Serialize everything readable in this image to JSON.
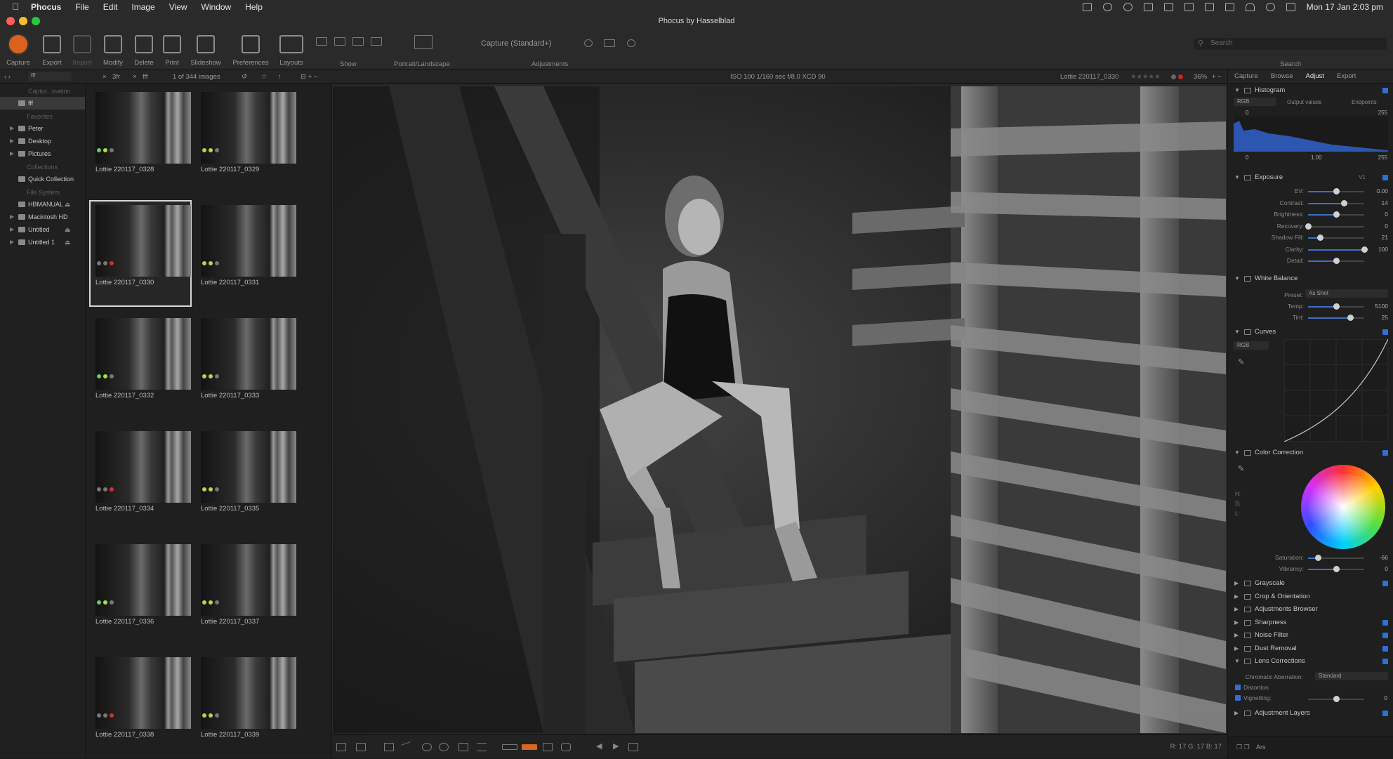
{
  "menubar": {
    "app": "Phocus",
    "items": [
      "File",
      "Edit",
      "Image",
      "View",
      "Window",
      "Help"
    ],
    "clock": "Mon 17 Jan  2:03 pm"
  },
  "window": {
    "title": "Phocus by Hasselblad"
  },
  "toolbar": {
    "buttons": [
      "Capture",
      "Export",
      "Import",
      "Modify",
      "Delete",
      "Print",
      "Slideshow",
      "Preferences",
      "Layouts"
    ],
    "show_label": "Show",
    "orientation_label": "Portrait/Landscape",
    "capture_preset": "Capture (Standard+)",
    "adjustments_label": "Adjustments",
    "search_placeholder": "Search",
    "search_label": "Search"
  },
  "subbar": {
    "tab1": "3fr",
    "tab2": "fff",
    "count": "1 of 344 images",
    "exif": "ISO 100   1/160 sec   f/8.0   XCD 90",
    "filename": "Lottie 220117_0330",
    "zoom": "36%"
  },
  "sidebar": {
    "path": "Captur...ination",
    "folder": "fff",
    "favorites_title": "Favorites",
    "favorites": [
      "Peter",
      "Desktop",
      "Pictures"
    ],
    "collections_title": "Collections",
    "quick": "Quick Collection",
    "filesystem_title": "File System",
    "volumes": [
      "HBMANUAL",
      "Macintosh HD",
      "Untitled",
      "Untitled 1"
    ]
  },
  "thumbnails": [
    "Lottie 220117_0328",
    "Lottie 220117_0329",
    "Lottie 220117_0330",
    "Lottie 220117_0331",
    "Lottie 220117_0332",
    "Lottie 220117_0333",
    "Lottie 220117_0334",
    "Lottie 220117_0335",
    "Lottie 220117_0336",
    "Lottie 220117_0337",
    "Lottie 220117_0338",
    "Lottie 220117_0339"
  ],
  "inspector": {
    "tabs": [
      "Capture",
      "Browse",
      "Adjust",
      "Export"
    ],
    "histogram": {
      "title": "Histogram",
      "channel": "RGB",
      "output": "Output values",
      "endpoints": "Endpoints",
      "v0": "0",
      "v255": "255",
      "lo": "0",
      "mid": "1.00",
      "hi": "255"
    },
    "exposure": {
      "title": "Exposure",
      "version": "V1",
      "rows": [
        {
          "name": "EV:",
          "value": "0.00",
          "pos": 0.5
        },
        {
          "name": "Contrast:",
          "value": "14",
          "pos": 0.64
        },
        {
          "name": "Brightness:",
          "value": "0",
          "pos": 0.5
        },
        {
          "name": "Recovery:",
          "value": "0",
          "pos": 0.0
        },
        {
          "name": "Shadow Fill:",
          "value": "21",
          "pos": 0.21
        },
        {
          "name": "Clarity:",
          "value": "100",
          "pos": 1.0
        },
        {
          "name": "Detail:",
          "value": "",
          "pos": 0.5
        }
      ]
    },
    "white_balance": {
      "title": "White Balance",
      "preset_label": "Preset:",
      "preset_value": "As Shot",
      "rows": [
        {
          "name": "Temp:",
          "value": "5100",
          "pos": 0.5
        },
        {
          "name": "Tint:",
          "value": "25",
          "pos": 0.75
        }
      ]
    },
    "curves": {
      "title": "Curves",
      "channel": "RGB"
    },
    "color_correction": {
      "title": "Color Correction",
      "hsl": [
        "H:",
        "S:",
        "L:"
      ],
      "rows": [
        {
          "name": "Saturation:",
          "value": "-66",
          "pos": 0.17
        },
        {
          "name": "Vibrancy:",
          "value": "0",
          "pos": 0.5
        }
      ]
    },
    "panels": [
      "Grayscale",
      "Crop & Orientation",
      "Adjustments Browser",
      "Sharpness",
      "Noise Filter",
      "Dust Removal",
      "Lens Corrections"
    ],
    "lens": {
      "ca_label": "Chromatic Aberration:",
      "ca_value": "Standard",
      "distortion": "Distortion",
      "vignetting": "Vignetting:",
      "vig_value": "0"
    },
    "adjustment_layers": "Adjustment Layers",
    "footer": "Ars"
  },
  "readout": "R: 17  G: 17  B: 17"
}
